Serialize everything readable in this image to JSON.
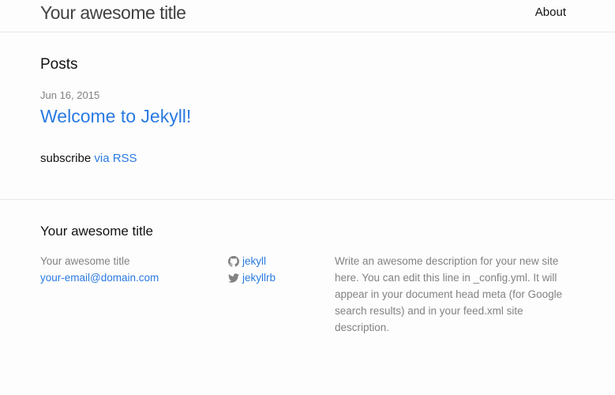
{
  "header": {
    "site_title": "Your awesome title",
    "nav": {
      "about_label": "About"
    }
  },
  "main": {
    "heading": "Posts",
    "posts": [
      {
        "date": "Jun 16, 2015",
        "title": "Welcome to Jekyll!"
      }
    ],
    "subscribe_text": "subscribe",
    "rss_link_text": "via RSS"
  },
  "footer": {
    "heading": "Your awesome title",
    "site_title": "Your awesome title",
    "email": "your-email@domain.com",
    "github": {
      "username": "jekyll",
      "icon": "github-icon"
    },
    "twitter": {
      "username": "jekyllrb",
      "icon": "twitter-icon"
    },
    "description": "Write an awesome description for your new site here. You can edit this line in _config.yml. It will appear in your document head meta (for Google search results) and in your feed.xml site description."
  },
  "colors": {
    "link": "#2a7ae2",
    "meta_text": "#828282",
    "border": "#e8e8e8",
    "background": "#fdfdfd"
  }
}
